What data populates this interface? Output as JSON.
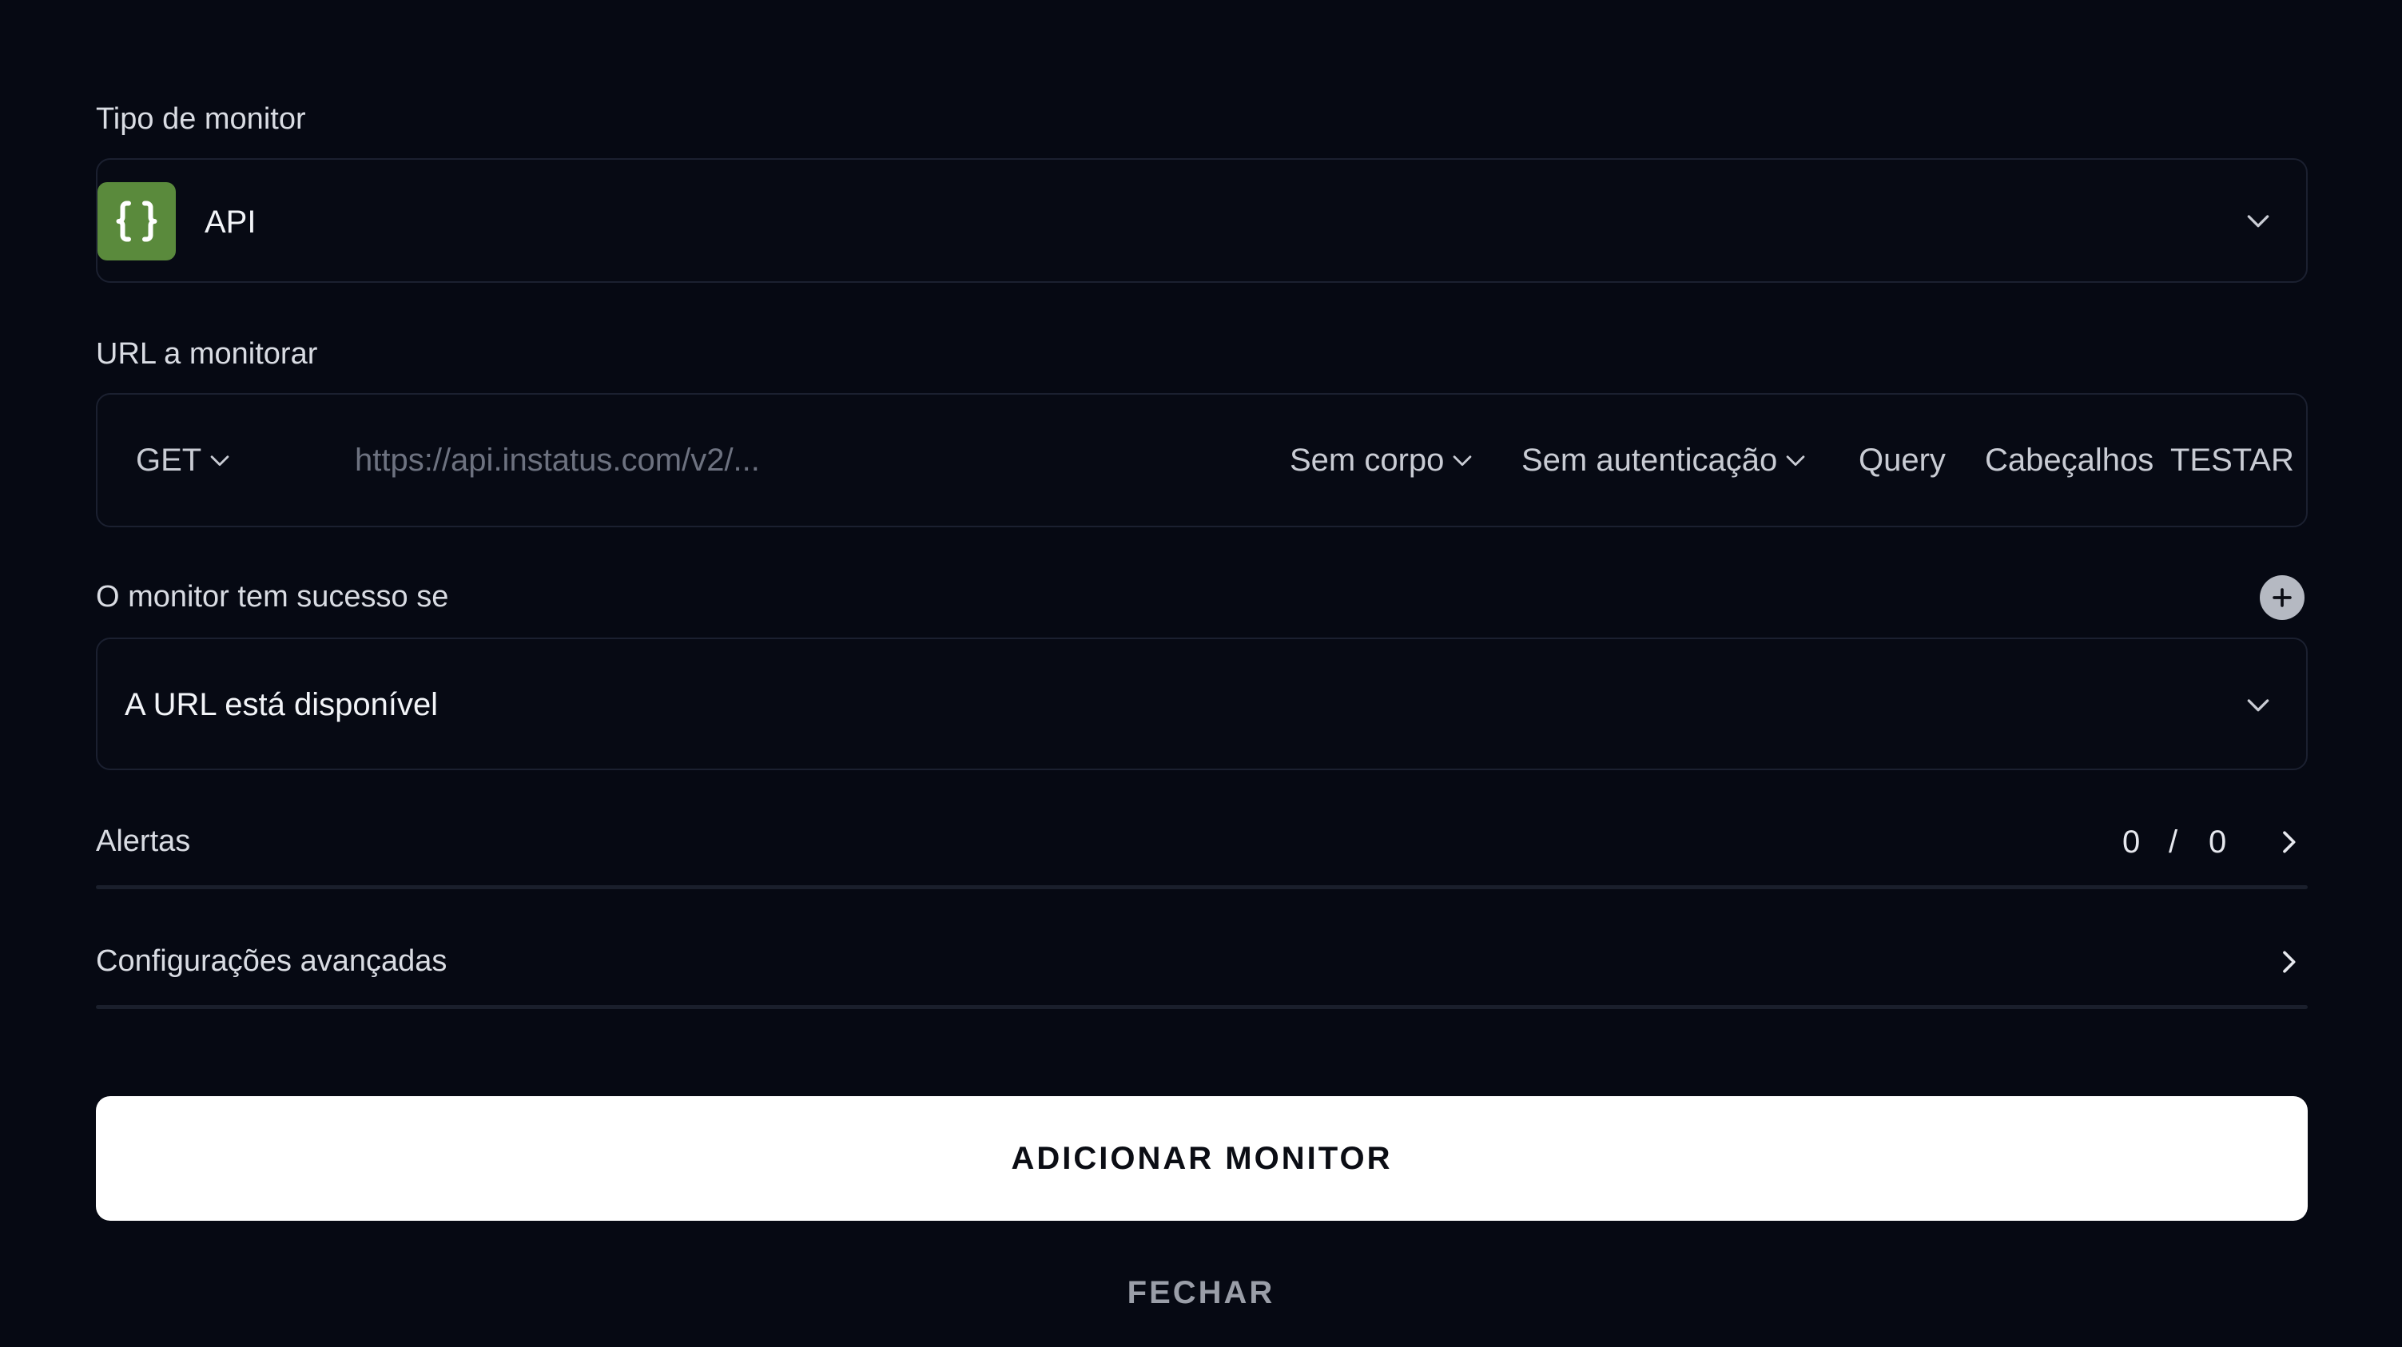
{
  "monitor_type": {
    "label": "Tipo de monitor",
    "value": "API",
    "badge_color": "#5a8a3c",
    "icon": "curly-braces-icon"
  },
  "url": {
    "label": "URL a monitorar",
    "method": "GET",
    "placeholder": "https://api.instatus.com/v2/...",
    "value": "",
    "body_label": "Sem corpo",
    "auth_label": "Sem autenticação",
    "query_label": "Query",
    "headers_label": "Cabeçalhos",
    "test_label": "TESTAR"
  },
  "success": {
    "label": "O monitor tem sucesso se",
    "condition": "A URL está disponível"
  },
  "alerts": {
    "label": "Alertas",
    "active": "0",
    "separator": "/",
    "total": "0"
  },
  "advanced": {
    "label": "Configurações avançadas"
  },
  "actions": {
    "add_label": "ADICIONAR MONITOR",
    "close_label": "FECHAR"
  },
  "colors": {
    "background": "#060913",
    "border": "#1b2030",
    "primary_button": "#ffffff"
  }
}
